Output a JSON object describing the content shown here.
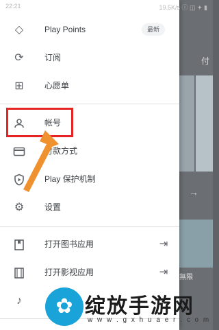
{
  "statusbar": {
    "time": "22:21",
    "right": "19.5K/s ⓘ ◫ ✦ ▮"
  },
  "background": {
    "fu": "付",
    "arrow": "→",
    "wuxian": "無限"
  },
  "menu": {
    "play_points": {
      "icon": "diamond-icon",
      "label": "Play Points",
      "badge": "最新"
    },
    "subscriptions": {
      "icon": "sync-icon",
      "label": "订阅"
    },
    "wishlist": {
      "icon": "bookmark-add-icon",
      "label": "心愿单"
    },
    "account": {
      "icon": "person-icon",
      "label": "帐号"
    },
    "payment": {
      "icon": "credit-card-icon",
      "label": "付款方式"
    },
    "play_protect": {
      "icon": "shield-play-icon",
      "label": "Play 保护机制"
    },
    "settings": {
      "icon": "gear-icon",
      "label": "设置"
    },
    "open_books": {
      "icon": "book-icon",
      "label": "打开图书应用"
    },
    "open_movies": {
      "icon": "film-icon",
      "label": "打开影视应用"
    },
    "open_music": {
      "icon": "music-icon",
      "label": ""
    }
  },
  "annotation": {
    "highlight_color": "#e52424",
    "arrow_color": "#f0912f"
  },
  "watermark": {
    "title": "绽放手游网",
    "url": "w w w . g x h u a e r . c o m"
  }
}
